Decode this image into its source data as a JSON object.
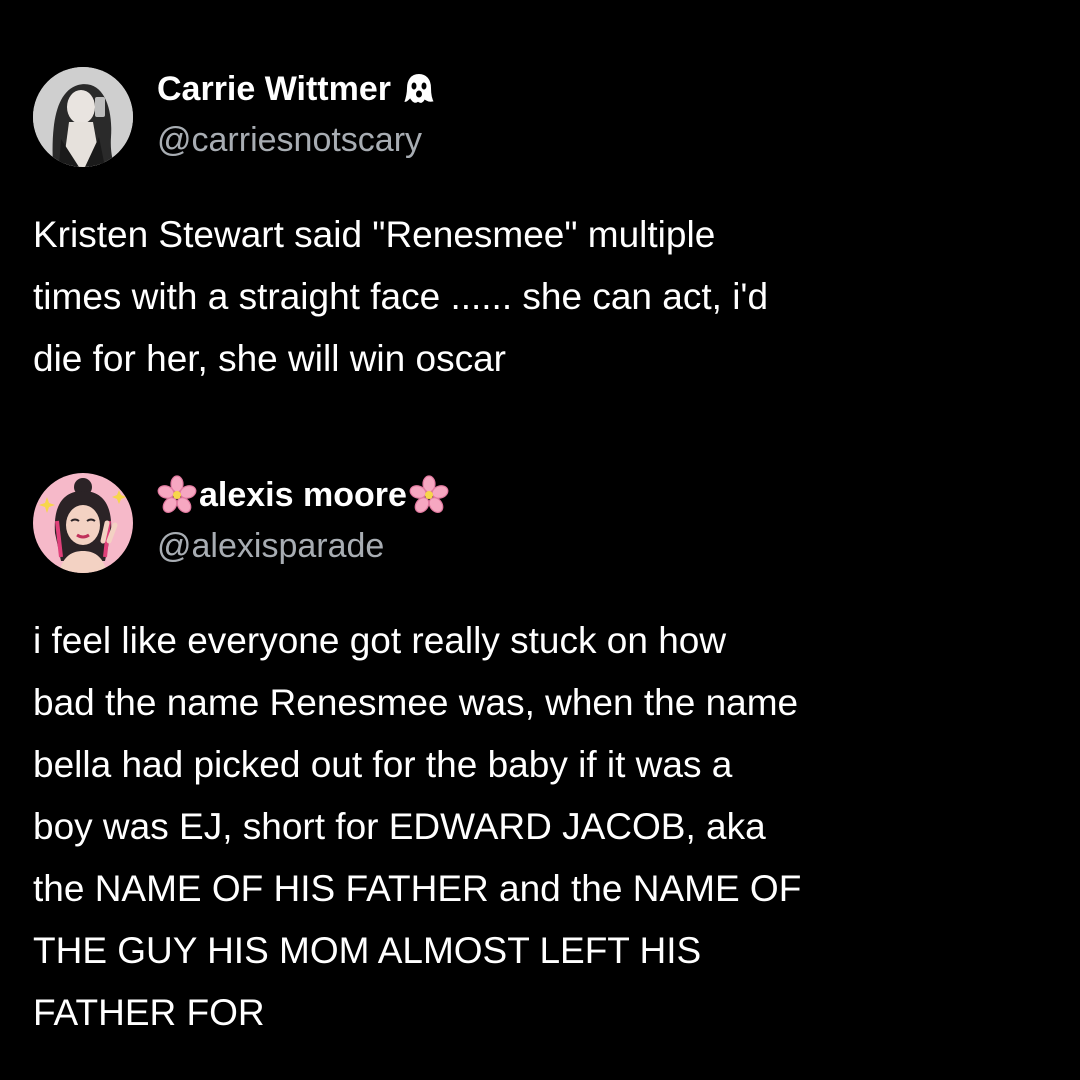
{
  "tweets": [
    {
      "author": {
        "display_name": "Carrie Wittmer",
        "name_emoji": "ghost-icon",
        "handle": "@carriesnotscary",
        "avatar": "avatar-photo"
      },
      "text_lines": [
        "Kristen Stewart said \"Renesmee\" multiple",
        "times with a straight face ...... she can act, i'd",
        "die for her, she will win oscar"
      ]
    },
    {
      "author": {
        "display_name": "alexis moore",
        "name_emoji": "cherry-blossom-icon",
        "handle": "@alexisparade",
        "avatar": "avatar-illustration"
      },
      "text_lines": [
        "i feel like everyone got really stuck on how",
        "bad the name Renesmee was, when the name",
        "bella had picked out for the baby if it was a",
        "boy was EJ, short for EDWARD JACOB, aka",
        "the NAME OF HIS FATHER and the NAME OF",
        "THE GUY HIS MOM ALMOST LEFT HIS",
        "FATHER FOR"
      ]
    }
  ],
  "colors": {
    "background": "#000000",
    "text": "#ffffff",
    "handle": "#a8adb3"
  }
}
